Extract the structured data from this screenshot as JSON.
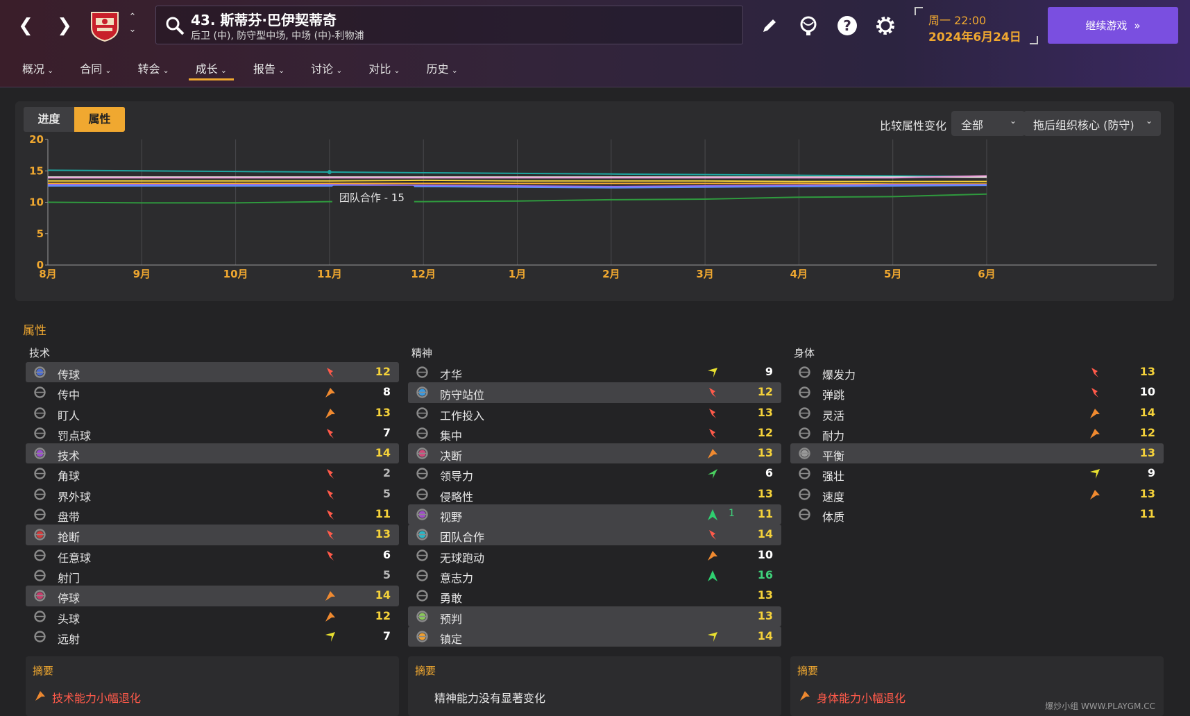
{
  "header": {
    "player_name": "43. 斯蒂芬·巴伊契蒂奇",
    "player_position": "后卫 (中), 防守型中场, 中场 (中)-利物浦",
    "date_day": "周一 22:00",
    "date_full": "2024年6月24日",
    "continue_label": "继续游戏"
  },
  "tabs": [
    {
      "label": "概况"
    },
    {
      "label": "合同"
    },
    {
      "label": "转会"
    },
    {
      "label": "成长"
    },
    {
      "label": "报告"
    },
    {
      "label": "讨论"
    },
    {
      "label": "对比"
    },
    {
      "label": "历史"
    }
  ],
  "chart_panel": {
    "seg_progress": "进度",
    "seg_attributes": "属性",
    "compare_label": "比较属性变化",
    "filter_value": "全部",
    "role_value": "拖后组织核心 (防守)"
  },
  "chart_data": {
    "type": "line",
    "x": [
      "8月",
      "9月",
      "10月",
      "11月",
      "12月",
      "1月",
      "2月",
      "3月",
      "4月",
      "5月",
      "6月"
    ],
    "ylim": [
      0,
      20
    ],
    "yticks": [
      0,
      5,
      10,
      15,
      20
    ],
    "grid": true,
    "tooltip": "团队合作 - 15",
    "series": [
      {
        "color": "#1fa6a0",
        "values": [
          15.1,
          15.0,
          14.9,
          14.8,
          14.7,
          14.6,
          14.5,
          14.4,
          14.3,
          14.2,
          14.1
        ]
      },
      {
        "color": "#f4f0e8",
        "values": [
          14.0,
          14.0,
          14.0,
          14.0,
          14.0,
          14.0,
          14.0,
          14.0,
          14.0,
          14.0,
          14.0
        ]
      },
      {
        "color": "#e99ad8",
        "values": [
          13.9,
          13.9,
          13.9,
          13.9,
          13.9,
          13.9,
          13.9,
          13.9,
          13.9,
          13.9,
          14.2
        ]
      },
      {
        "color": "#f5d23a",
        "values": [
          13.4,
          13.4,
          13.4,
          13.4,
          13.5,
          13.4,
          13.4,
          13.4,
          13.3,
          13.3,
          13.3
        ]
      },
      {
        "color": "#f0a830",
        "values": [
          13.0,
          13.0,
          13.0,
          13.0,
          13.0,
          13.0,
          13.0,
          13.0,
          13.0,
          12.9,
          12.9
        ]
      },
      {
        "color": "#9b6cf0",
        "values": [
          12.8,
          12.8,
          12.8,
          12.8,
          12.7,
          12.6,
          12.5,
          12.6,
          12.7,
          12.8,
          12.8
        ]
      },
      {
        "color": "#5b8ef5",
        "values": [
          12.6,
          12.6,
          12.6,
          12.6,
          12.5,
          12.4,
          12.3,
          12.4,
          12.5,
          12.6,
          12.7
        ]
      },
      {
        "color": "#2f9a3e",
        "values": [
          10.0,
          9.9,
          9.9,
          10.1,
          10.1,
          10.2,
          10.4,
          10.5,
          10.8,
          10.9,
          11.3
        ]
      }
    ]
  },
  "attributes": {
    "section_title": "属性",
    "technical": {
      "title": "技术",
      "rows": [
        {
          "name": "传球",
          "value": "12",
          "dir": "down",
          "hl": true,
          "ico": "#4a6cd4",
          "vc": "#f5d23a"
        },
        {
          "name": "传中",
          "value": "8",
          "dir": "up",
          "hl": false,
          "ico": "",
          "vc": "#ffffff"
        },
        {
          "name": "盯人",
          "value": "13",
          "dir": "up",
          "hl": false,
          "ico": "",
          "vc": "#f5d23a"
        },
        {
          "name": "罚点球",
          "value": "7",
          "dir": "down",
          "hl": false,
          "ico": "",
          "vc": "#ffffff"
        },
        {
          "name": "技术",
          "value": "14",
          "dir": "none",
          "hl": true,
          "ico": "#9b4fd0",
          "vc": "#f5d23a"
        },
        {
          "name": "角球",
          "value": "2",
          "dir": "down",
          "hl": false,
          "ico": "",
          "vc": "#b8b8b8"
        },
        {
          "name": "界外球",
          "value": "5",
          "dir": "down",
          "hl": false,
          "ico": "",
          "vc": "#b8b8b8"
        },
        {
          "name": "盘带",
          "value": "11",
          "dir": "down",
          "hl": false,
          "ico": "",
          "vc": "#f5d23a"
        },
        {
          "name": "抢断",
          "value": "13",
          "dir": "down",
          "hl": true,
          "ico": "#d43a3a",
          "vc": "#f5d23a"
        },
        {
          "name": "任意球",
          "value": "6",
          "dir": "down",
          "hl": false,
          "ico": "",
          "vc": "#ffffff"
        },
        {
          "name": "射门",
          "value": "5",
          "dir": "none",
          "hl": false,
          "ico": "",
          "vc": "#b8b8b8"
        },
        {
          "name": "停球",
          "value": "14",
          "dir": "up",
          "hl": true,
          "ico": "#c83a6a",
          "vc": "#f5d23a"
        },
        {
          "name": "头球",
          "value": "12",
          "dir": "up",
          "hl": false,
          "ico": "",
          "vc": "#f5d23a"
        },
        {
          "name": "远射",
          "value": "7",
          "dir": "upright",
          "hl": false,
          "ico": "",
          "vc": "#ffffff"
        }
      ]
    },
    "mental": {
      "title": "精神",
      "rows": [
        {
          "name": "才华",
          "value": "9",
          "dir": "upright",
          "hl": false,
          "ico": "",
          "vc": "#ffffff"
        },
        {
          "name": "防守站位",
          "value": "12",
          "dir": "down",
          "hl": true,
          "ico": "#3a9ae0",
          "vc": "#f5d23a"
        },
        {
          "name": "工作投入",
          "value": "13",
          "dir": "down",
          "hl": false,
          "ico": "",
          "vc": "#f5d23a"
        },
        {
          "name": "集中",
          "value": "12",
          "dir": "down",
          "hl": false,
          "ico": "",
          "vc": "#f5d23a"
        },
        {
          "name": "决断",
          "value": "13",
          "dir": "up",
          "hl": true,
          "ico": "#d04a7a",
          "vc": "#f5d23a"
        },
        {
          "name": "领导力",
          "value": "6",
          "dir": "greenup",
          "hl": false,
          "ico": "",
          "vc": "#ffffff"
        },
        {
          "name": "侵略性",
          "value": "13",
          "dir": "none",
          "hl": false,
          "ico": "",
          "vc": "#f5d23a"
        },
        {
          "name": "视野",
          "value": "11",
          "dir": "bigup",
          "delta": "1",
          "hl": true,
          "ico": "#a04fc8",
          "vc": "#f5d23a"
        },
        {
          "name": "团队合作",
          "value": "14",
          "dir": "down",
          "hl": true,
          "ico": "#2ab8c8",
          "vc": "#f5d23a"
        },
        {
          "name": "无球跑动",
          "value": "10",
          "dir": "up",
          "hl": false,
          "ico": "",
          "vc": "#ffffff"
        },
        {
          "name": "意志力",
          "value": "16",
          "dir": "bigup",
          "hl": false,
          "ico": "",
          "vc": "#3fd17a"
        },
        {
          "name": "勇敢",
          "value": "13",
          "dir": "none",
          "hl": false,
          "ico": "",
          "vc": "#f5d23a"
        },
        {
          "name": "预判",
          "value": "13",
          "dir": "none",
          "hl": true,
          "ico": "#8ac85a",
          "vc": "#f5d23a"
        },
        {
          "name": "镇定",
          "value": "14",
          "dir": "upright",
          "hl": true,
          "ico": "#f0a030",
          "vc": "#f5d23a"
        }
      ]
    },
    "physical": {
      "title": "身体",
      "rows": [
        {
          "name": "爆发力",
          "value": "13",
          "dir": "down",
          "hl": false,
          "ico": "",
          "vc": "#f5d23a"
        },
        {
          "name": "弹跳",
          "value": "10",
          "dir": "down",
          "hl": false,
          "ico": "",
          "vc": "#ffffff"
        },
        {
          "name": "灵活",
          "value": "14",
          "dir": "up",
          "hl": false,
          "ico": "",
          "vc": "#f5d23a"
        },
        {
          "name": "耐力",
          "value": "12",
          "dir": "up",
          "hl": false,
          "ico": "",
          "vc": "#f5d23a"
        },
        {
          "name": "平衡",
          "value": "13",
          "dir": "none",
          "hl": true,
          "ico": "#9a9a9a",
          "vc": "#f5d23a"
        },
        {
          "name": "强壮",
          "value": "9",
          "dir": "upright",
          "hl": false,
          "ico": "",
          "vc": "#ffffff"
        },
        {
          "name": "速度",
          "value": "13",
          "dir": "up",
          "hl": false,
          "ico": "",
          "vc": "#f5d23a"
        },
        {
          "name": "体质",
          "value": "11",
          "dir": "none",
          "hl": false,
          "ico": "",
          "vc": "#f5d23a"
        }
      ]
    }
  },
  "summaries": {
    "tech": {
      "title": "摘要",
      "text": "技术能力小幅退化",
      "color": "#ff5a4a"
    },
    "mental": {
      "title": "摘要",
      "text": "精神能力没有显著变化",
      "color": "#e6e6e6"
    },
    "physical": {
      "title": "摘要",
      "text": "身体能力小幅退化",
      "color": "#ff5a4a"
    }
  },
  "watermark": "爆炒小组 WWW.PLAYGM.CC",
  "colors": {
    "accent": "#f0a830",
    "continue": "#7a4fe0",
    "panel": "#2c2c2e"
  }
}
